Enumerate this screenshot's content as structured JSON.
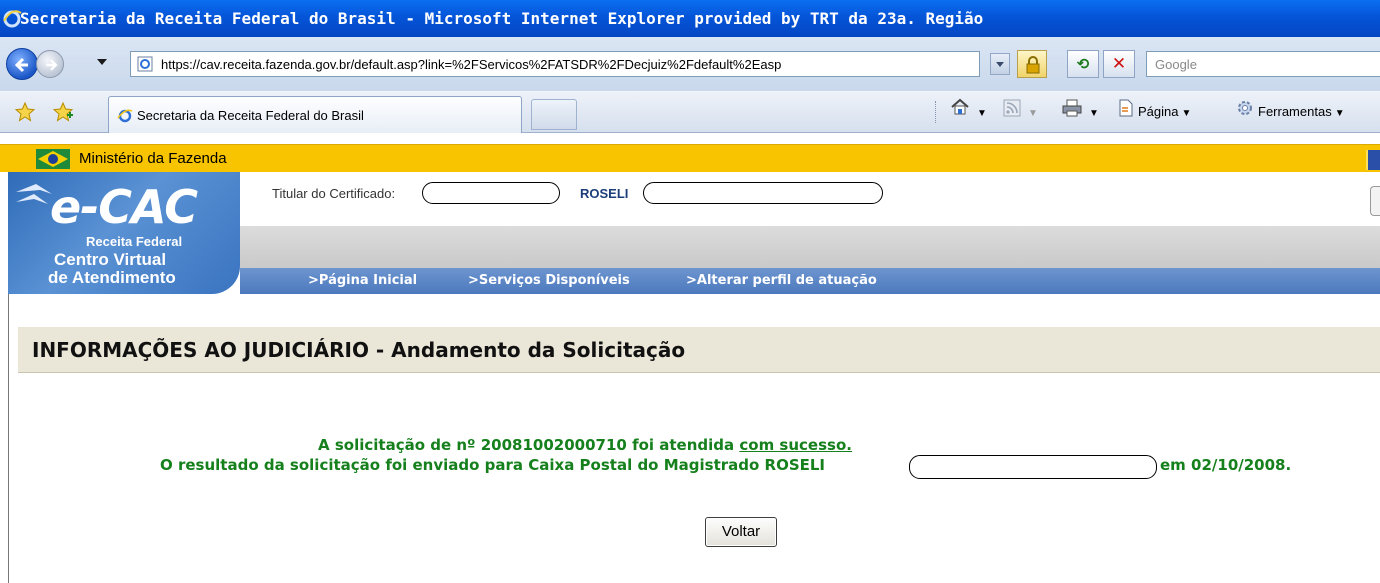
{
  "window": {
    "title": "Secretaria da Receita Federal do Brasil - Microsoft Internet Explorer provided by TRT da 23a. Região"
  },
  "addressbar": {
    "url": "https://cav.receita.fazenda.gov.br/default.asp?link=%2FServicos%2FATSDR%2FDecjuiz%2Fdefault%2Easp",
    "search_placeholder": "Google"
  },
  "tabs": {
    "active_label": "Secretaria da Receita Federal do Brasil"
  },
  "commandbar": {
    "page_label": "Página",
    "tools_label": "Ferramentas"
  },
  "ministry": {
    "label": "Ministério da Fazenda"
  },
  "ecac": {
    "logo_title": "e-CAC",
    "logo_sub1": "Receita Federal",
    "logo_sub2": "Centro Virtual",
    "logo_sub3": "de Atendimento",
    "cert_label": "Titular do Certificado:",
    "cert_name": "ROSELI"
  },
  "nav": {
    "home": ">Página Inicial",
    "services": ">Serviços Disponíveis",
    "profile": ">Alterar perfil de atuação"
  },
  "content": {
    "section_title": "INFORMAÇÕES AO JUDICIÁRIO - Andamento da Solicitação",
    "msg1_pre": "A solicitação de nº 20081002000710 foi atendida ",
    "msg1_underlined": "com sucesso.",
    "msg2_pre": "O resultado da solicitação foi enviado para Caixa Postal do Magistrado ROSELI",
    "msg2_post": "em 02/10/2008.",
    "back_button": "Voltar"
  },
  "colors": {
    "title_bar": "#0555d8",
    "ministry_bar": "#f8c400",
    "nav_bar": "#4c79bd",
    "success_text": "#15801c",
    "section_header_bg": "#eae7d8"
  }
}
